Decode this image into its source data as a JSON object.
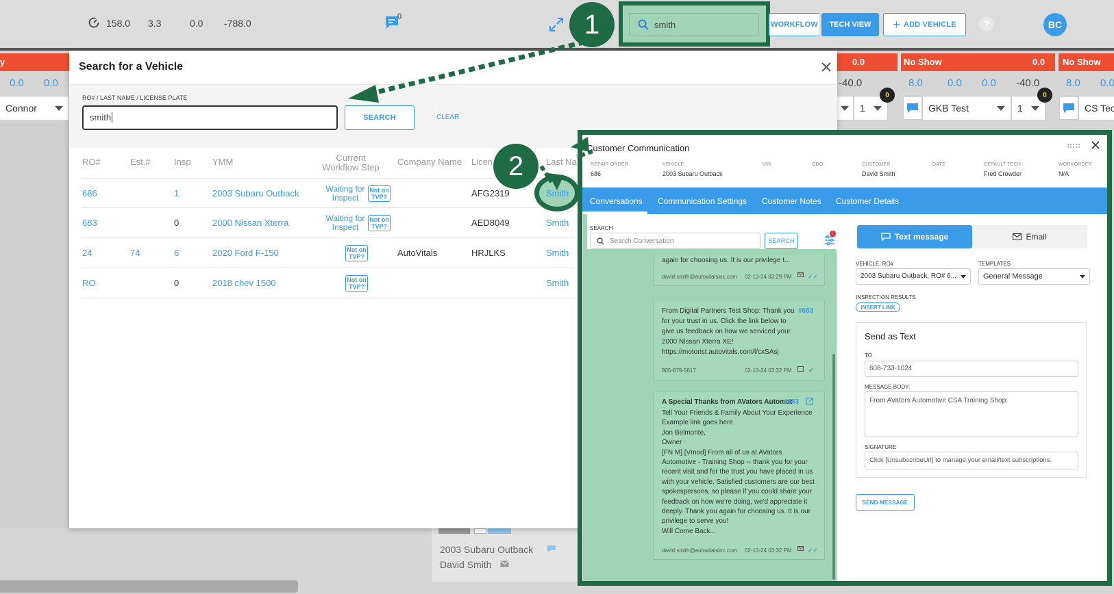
{
  "header": {
    "stats": [
      "158.0",
      "3.3",
      "0.0",
      "-788.0"
    ],
    "chat_count": "0",
    "search_value": "smith",
    "workflow_label": "WORKFLOW",
    "tech_view_label": "TECH VIEW",
    "add_vehicle_label": "ADD VEHICLE",
    "avatar_initials": "BC"
  },
  "callouts": {
    "one": "1",
    "two": "2"
  },
  "board": {
    "red_left": "y",
    "red_values": [
      "0.0",
      "No Show",
      "0.0",
      "No Show"
    ],
    "left_values": [
      "0.0",
      "0.0"
    ],
    "col_values": [
      "-40.0",
      "8.0",
      "0.0",
      "0.0",
      "-40.0",
      "8.0",
      "0.0"
    ],
    "sel_left": "Connor",
    "sel_qty": "1",
    "sel_gkb": "GKB Test",
    "sel_qty2": "1",
    "sel_cs": "CS Tec",
    "badge": "0",
    "bottom_vehicle": "2003 Subaru Outback",
    "bottom_customer": "David Smith"
  },
  "search_modal": {
    "title": "Search for a Vehicle",
    "field_label": "RO# / LAST NAME / LICENSE PLATE",
    "field_value": "smith",
    "search_label": "SEARCH",
    "clear_label": "CLEAR",
    "columns": [
      "RO#",
      "Est.#",
      "Insp",
      "YMM",
      "Current Workflow Step",
      "Company Name",
      "Licen",
      "Last Na"
    ],
    "tvp_label": "Not on TVP?",
    "rows": [
      {
        "ro": "686",
        "est": "",
        "insp": "1",
        "ymm": "2003 Subaru Outback",
        "step": "Waiting for Inspect",
        "company": "",
        "plate": "AFG2319",
        "last": "Smith"
      },
      {
        "ro": "683",
        "est": "",
        "insp": "0",
        "ymm": "2000 Nissan Xterra",
        "step": "Waiting for Inspect",
        "company": "",
        "plate": "AED8049",
        "last": "Smith"
      },
      {
        "ro": "24",
        "est": "74",
        "insp": "6",
        "ymm": "2020 Ford F-150",
        "step": "",
        "company": "AutoVitals",
        "plate": "HRJLKS",
        "last": "Smith"
      },
      {
        "ro": "RO",
        "est": "",
        "insp": "0",
        "ymm": "2018 chev 1500",
        "step": "",
        "company": "",
        "plate": "",
        "last": "Smith"
      }
    ]
  },
  "comm": {
    "title": "Customer Communication",
    "meta": [
      {
        "label": "REPAIR ORDER",
        "value": "686"
      },
      {
        "label": "VEHICLE",
        "value": "2003 Subaru Outback"
      },
      {
        "label": "VIN",
        "value": ""
      },
      {
        "label": "ODO",
        "value": ""
      },
      {
        "label": "CUSTOMER",
        "value": "David Smith"
      },
      {
        "label": "DATE",
        "value": ""
      },
      {
        "label": "DEFAULT TECH",
        "value": "Fred Crowder"
      },
      {
        "label": "WORKORDER",
        "value": "N/A"
      }
    ],
    "tabs": [
      "Conversations",
      "Communication Settings",
      "Customer Notes",
      "Customer Details"
    ],
    "search_label": "SEARCH",
    "search_placeholder": "Search Conversation",
    "search_button": "SEARCH",
    "filter_badge": "1",
    "messages": [
      {
        "body": "again for choosing us. It is our privilege t...",
        "from": "david.smith@autovitalsinc.com",
        "time": "02-13-24 03:29 PM"
      },
      {
        "ro": "#683",
        "body": "From Digital Partners Test Shop: Thank you for your trust in us. Click the link below to give us feedback on how we serviced your 2000 Nissan Xterra XE! https://motorist.autovitals.com/l/cxSAsj",
        "from": "805-879-5617",
        "time": "02-13-24 03:32 PM"
      },
      {
        "title": "A Special Thanks from AVators Automot...",
        "ro": "#683",
        "body": "Tell Your Friends & Family About Your Experience Example link goes here\nJon Belmonte,\nOwner\n[FN M] [Vmod] From all of us at AVators Automotive - Training Shop -- thank you for your recent visit and for the trust you have placed in us with your vehicle. Satisfied customers are our best spokespersons, so please if you could share your feedback on how we're doing, we'd appreciate it deeply. Thank you again for choosing us. It is our privilege to serve you!\nWill Come Back...",
        "from": "david.smith@autovitalsinc.com",
        "time": "02-13-24 03:32 PM"
      }
    ],
    "text_tab": "Text message",
    "email_tab": "Email",
    "vehicle_label": "VEHICLE, RO#",
    "vehicle_value": "2003 Subaru Outback, RO# 6...",
    "templates_label": "TEMPLATES",
    "templates_value": "General Message",
    "inspection_label": "INSPECTION RESULTS",
    "insert_link": "INSERT LINK",
    "send_as_text": "Send as Text",
    "to_label": "TO",
    "to_value": "608-733-1024",
    "body_label": "MESSAGE BODY:",
    "body_value": "From AVators Automotive CSA Training Shop:",
    "signature_label": "SIGNATURE",
    "signature_value": "Click [UnsubscribeUrl] to manage your email/text subscriptions.",
    "send_button": "SEND MESSAGE"
  },
  "colors": {
    "accent": "#3a9be8",
    "red": "#ee4f32",
    "highlight": "#1f6b45",
    "highlight_fill": "#9fd4b7"
  }
}
